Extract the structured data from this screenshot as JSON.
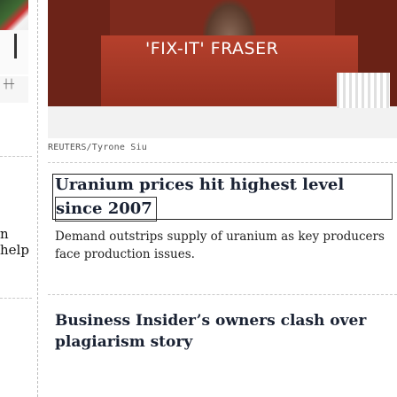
{
  "left_column": {
    "fragment_1": "n",
    "fragment_2": "help"
  },
  "hero": {
    "banner_text": "'FIX-IT' FRASER",
    "photo_credit": "REUTERS/Tyrone Siu"
  },
  "articles": [
    {
      "headline": "Uranium prices hit highest level since 2007",
      "headline_line1": "Uranium prices hit highest level",
      "headline_line2": "since 2007",
      "summary": "Demand outstrips supply of uranium as key producers face production issues."
    },
    {
      "headline": "Business Insider’s owners clash over plagiarism story",
      "summary": ""
    }
  ],
  "colors": {
    "headline": "#1a2233",
    "hero_banner": "#a83a28"
  }
}
